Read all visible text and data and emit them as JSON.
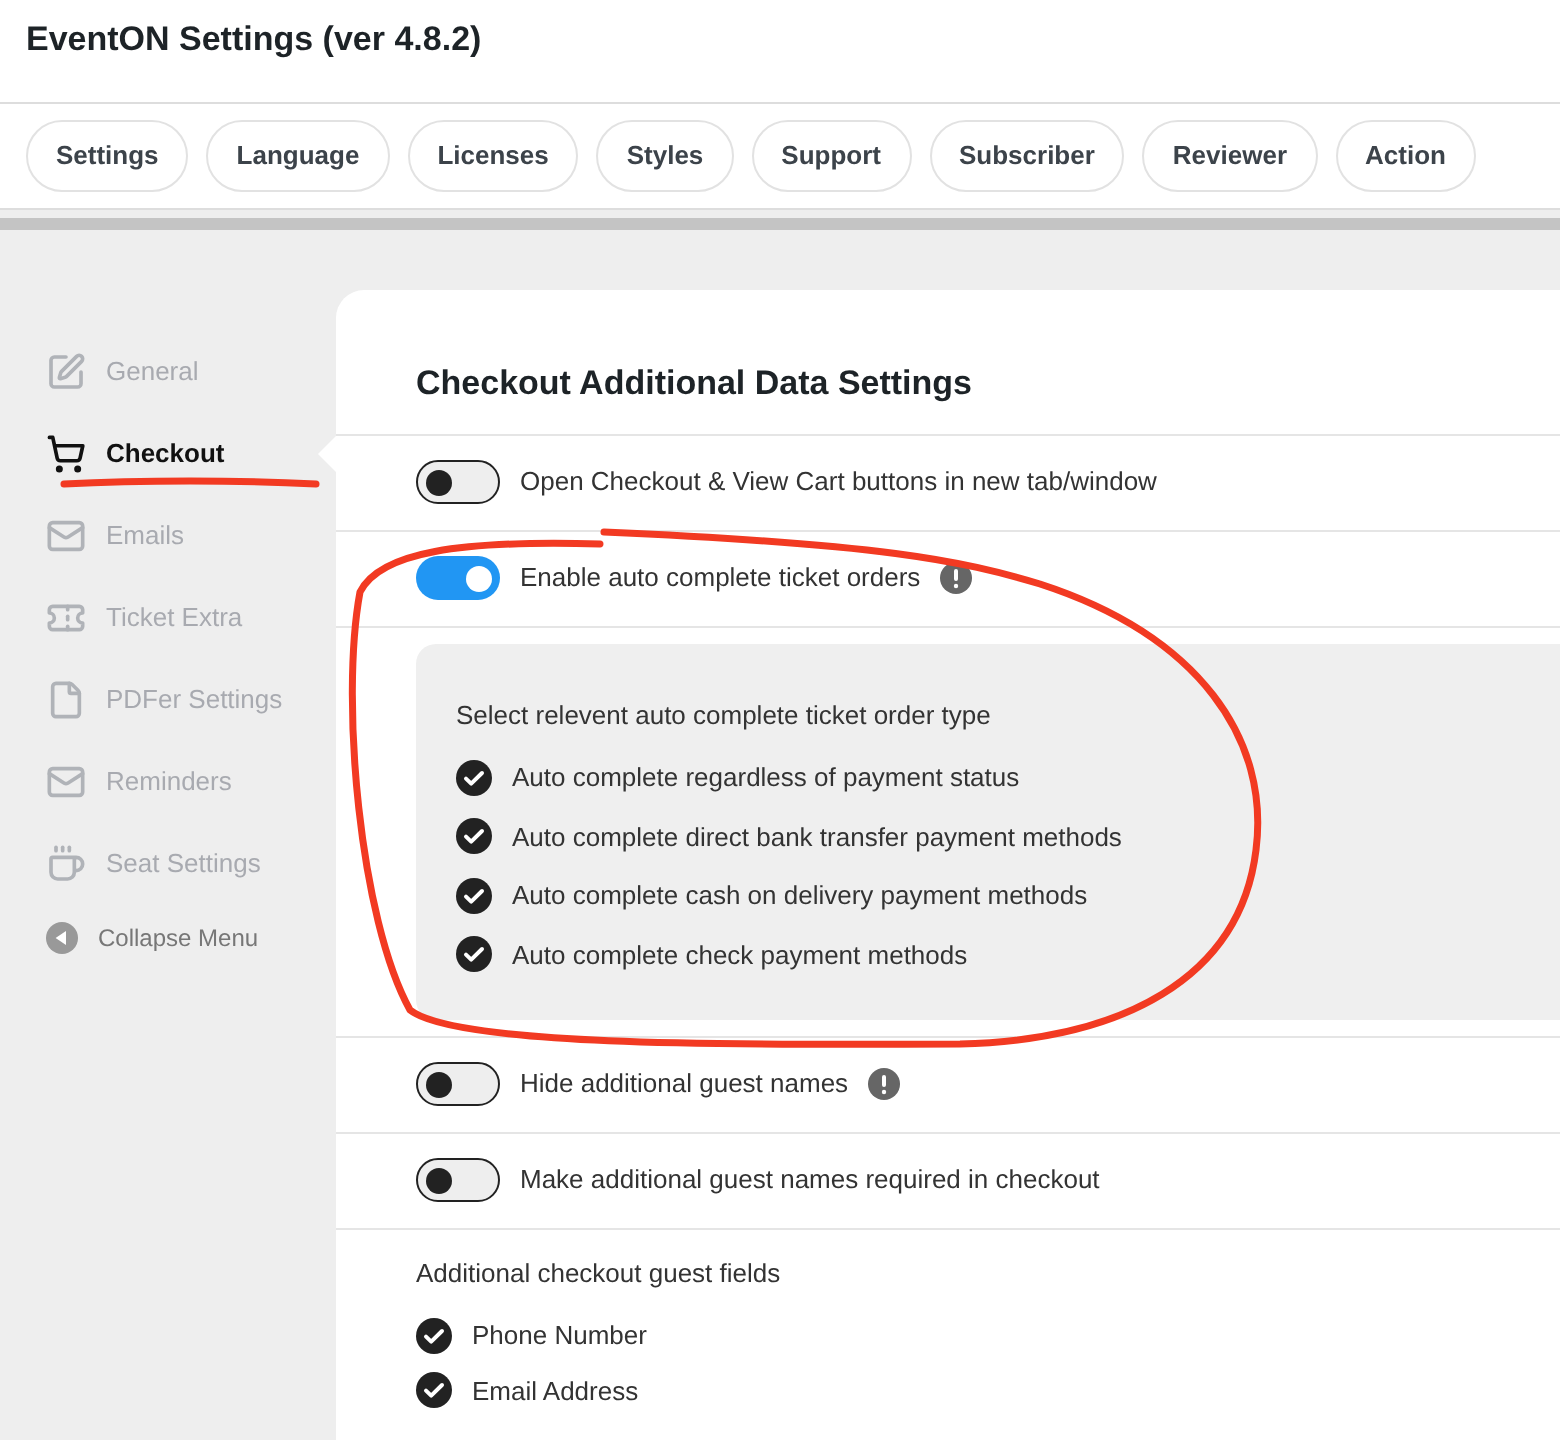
{
  "title": "EventON Settings (ver 4.8.2)",
  "tabs": [
    {
      "label": "Settings"
    },
    {
      "label": "Language"
    },
    {
      "label": "Licenses"
    },
    {
      "label": "Styles"
    },
    {
      "label": "Support"
    },
    {
      "label": "Subscriber"
    },
    {
      "label": "Reviewer"
    },
    {
      "label": "Action"
    }
  ],
  "sidebar": {
    "items": [
      {
        "label": "General",
        "selected": false
      },
      {
        "label": "Checkout",
        "selected": true
      },
      {
        "label": "Emails",
        "selected": false
      },
      {
        "label": "Ticket Extra",
        "selected": false
      },
      {
        "label": "PDFer Settings",
        "selected": false
      },
      {
        "label": "Reminders",
        "selected": false
      },
      {
        "label": "Seat Settings",
        "selected": false
      }
    ],
    "collapse": "Collapse Menu"
  },
  "heading": "Checkout Additional Data Settings",
  "settings": [
    {
      "kind": "toggle",
      "label": "Open Checkout & View Cart buttons in new tab/window",
      "on": false,
      "info": false
    },
    {
      "kind": "toggle",
      "label": "Enable auto complete ticket orders",
      "on": true,
      "info": true
    },
    {
      "kind": "box",
      "title": "Select relevent auto complete ticket order type",
      "options": [
        {
          "label": "Auto complete regardless of payment status",
          "checked": true
        },
        {
          "label": "Auto complete direct bank transfer payment methods",
          "checked": true
        },
        {
          "label": "Auto complete cash on delivery payment methods",
          "checked": true
        },
        {
          "label": "Auto complete check payment methods",
          "checked": true
        }
      ]
    },
    {
      "kind": "toggle",
      "label": "Hide additional guest names",
      "on": false,
      "info": true
    },
    {
      "kind": "toggle",
      "label": "Make additional guest names required in checkout",
      "on": false,
      "info": false
    },
    {
      "kind": "list",
      "title": "Additional checkout guest fields",
      "options": [
        {
          "label": "Phone Number",
          "checked": true
        },
        {
          "label": "Email Address",
          "checked": true
        }
      ]
    }
  ]
}
